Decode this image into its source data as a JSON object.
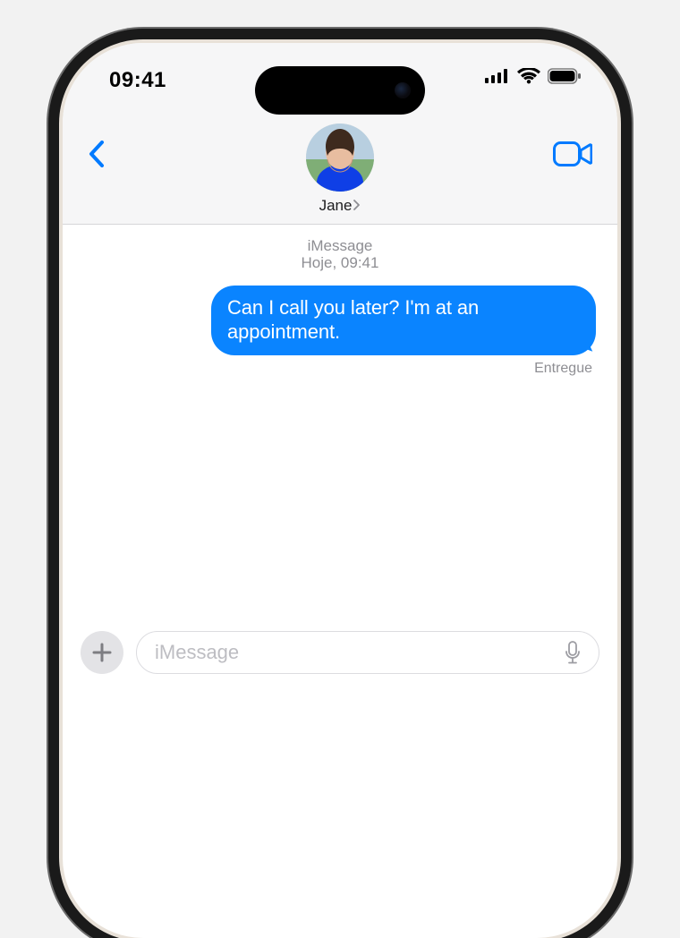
{
  "status": {
    "time": "09:41"
  },
  "header": {
    "contact_name": "Jane"
  },
  "conversation": {
    "type_label": "iMessage",
    "timestamp": "Hoje, 09:41",
    "messages": [
      {
        "from": "me",
        "text": "Can I call you later? I'm at an appointment."
      }
    ],
    "delivery_status": "Entregue"
  },
  "composer": {
    "placeholder": "iMessage"
  },
  "colors": {
    "accent_blue": "#007aff",
    "bubble_blue": "#0a84ff",
    "secondary_text": "#8e8e93"
  }
}
